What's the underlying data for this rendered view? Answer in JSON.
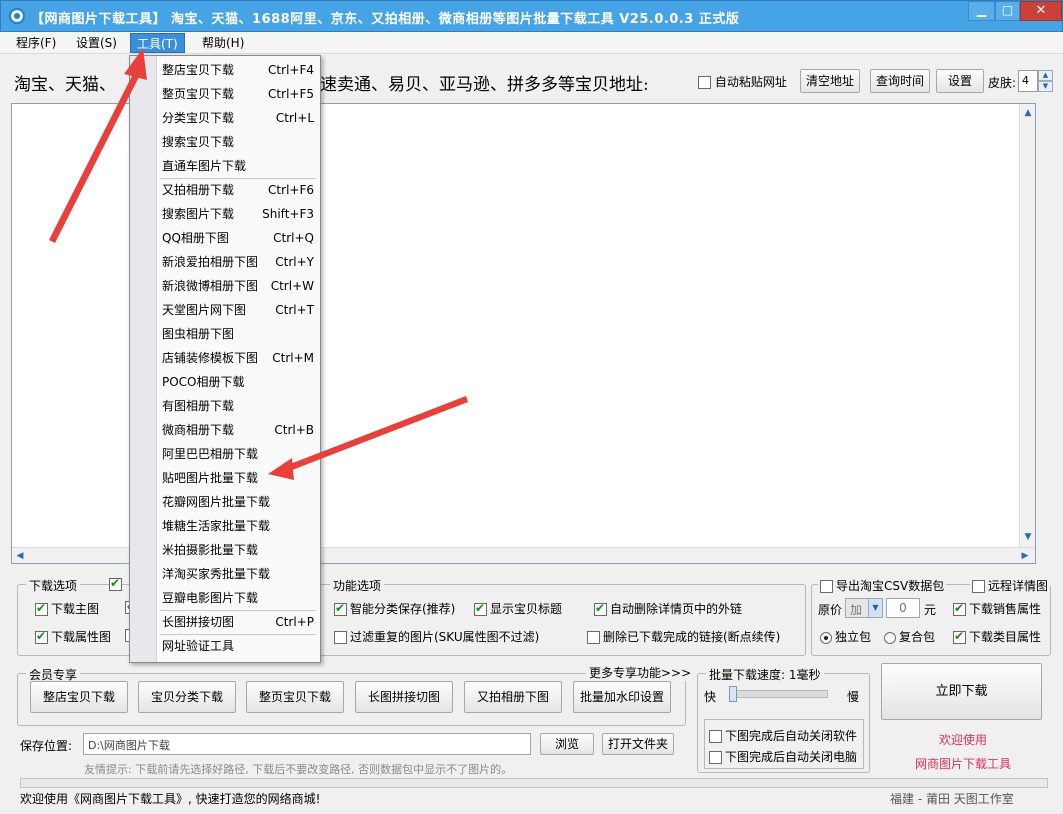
{
  "window": {
    "title": "【网商图片下载工具】 淘宝、天猫、1688阿里、京东、又拍相册、微商相册等图片批量下载工具 V25.0.0.3 正式版",
    "min_label": "▁",
    "max_label": "□",
    "close_label": "✕"
  },
  "menubar": [
    "程序(F)",
    "设置(S)",
    "工具(T)",
    "帮助(H)"
  ],
  "toolbar": {
    "url_label_a": "淘宝、天猫、",
    "url_label_b": "速卖通、易贝、亚马逊、拼多多等宝贝地址:",
    "auto_paste": "自动粘贴网址",
    "clear_url": "清空地址",
    "query_time": "查询时间",
    "settings": "设置",
    "skin_label": "皮肤:",
    "skin_value": "4"
  },
  "dropdown": [
    {
      "label": "整店宝贝下载",
      "shortcut": "Ctrl+F4"
    },
    {
      "label": "整页宝贝下载",
      "shortcut": "Ctrl+F5"
    },
    {
      "label": "分类宝贝下载",
      "shortcut": "Ctrl+L"
    },
    {
      "label": "搜索宝贝下载",
      "shortcut": ""
    },
    {
      "label": "直通车图片下载",
      "shortcut": ""
    },
    {
      "label": "又拍相册下载",
      "shortcut": "Ctrl+F6"
    },
    {
      "label": "搜索图片下载",
      "shortcut": "Shift+F3"
    },
    {
      "label": "QQ相册下图",
      "shortcut": "Ctrl+Q"
    },
    {
      "label": "新浪爱拍相册下图",
      "shortcut": "Ctrl+Y"
    },
    {
      "label": "新浪微博相册下图",
      "shortcut": "Ctrl+W"
    },
    {
      "label": "天堂图片网下图",
      "shortcut": "Ctrl+T"
    },
    {
      "label": "图虫相册下图",
      "shortcut": ""
    },
    {
      "label": "店铺装修模板下图",
      "shortcut": "Ctrl+M"
    },
    {
      "label": "POCO相册下载",
      "shortcut": ""
    },
    {
      "label": "有图相册下载",
      "shortcut": ""
    },
    {
      "label": "微商相册下载",
      "shortcut": "Ctrl+B"
    },
    {
      "label": "阿里巴巴相册下载",
      "shortcut": ""
    },
    {
      "label": "贴吧图片批量下载",
      "shortcut": ""
    },
    {
      "label": "花瓣网图片批量下载",
      "shortcut": ""
    },
    {
      "label": "堆糖生活家批量下载",
      "shortcut": ""
    },
    {
      "label": "米拍摄影批量下载",
      "shortcut": ""
    },
    {
      "label": "洋淘买家秀批量下载",
      "shortcut": ""
    },
    {
      "label": "豆瓣电影图片下载",
      "shortcut": ""
    },
    {
      "label": "长图拼接切图",
      "shortcut": "Ctrl+P"
    },
    {
      "label": "网址验证工具",
      "shortcut": ""
    }
  ],
  "download_options": {
    "title": "下载选项",
    "main_image": "下载主图",
    "attr_image": "下载属性图"
  },
  "function_options": {
    "title": "功能选项",
    "smart_save": "智能分类保存(推荐)",
    "show_title": "显示宝贝标题",
    "auto_remove_links": "自动删除详情页中的外链",
    "filter_dup": "过滤重复的图片(SKU属性图不过滤)",
    "remove_done_links": "删除已下载完成的链接(断点续传)"
  },
  "csv": {
    "export_title": "导出淘宝CSV数据包",
    "remote_detail": "远程详情图",
    "price_label": "原价",
    "price_op": "加",
    "price_value": "0",
    "yuan": "元",
    "sales_attr": "下载销售属性",
    "single_pack": "独立包",
    "combo_pack": "复合包",
    "category_attr": "下载类目属性"
  },
  "member": {
    "title": "会员专享",
    "more": "更多专享功能>>>",
    "buttons": [
      "整店宝贝下载",
      "宝贝分类下载",
      "整页宝贝下载",
      "长图拼接切图",
      "又拍相册下图",
      "批量加水印设置"
    ]
  },
  "speed": {
    "title": "批量下载速度: 1毫秒",
    "fast": "快",
    "slow": "慢",
    "close_software": "下图完成后自动关闭软件",
    "close_pc": "下图完成后自动关闭电脑",
    "speed_fraction": 0.0
  },
  "download_now": "立即下载",
  "welcome_line1": "欢迎使用",
  "welcome_line2": "网商图片下载工具",
  "save": {
    "label": "保存位置:",
    "path": "D:\\网商图片下载",
    "browse": "浏览",
    "open_folder": "打开文件夹",
    "tip": "友情提示: 下载前请先选择好路径, 下载后不要改变路径, 否则数据包中显示不了图片的。"
  },
  "status": {
    "left": "欢迎使用《网商图片下载工具》, 快速打造您的网络商城!",
    "right": "福建 - 莆田  天图工作室"
  },
  "colors": {
    "titlebar": "#46a4e6",
    "menu_active": "#3b8fd6",
    "welcome": "#e0305a",
    "arrow": "#e8403a"
  }
}
